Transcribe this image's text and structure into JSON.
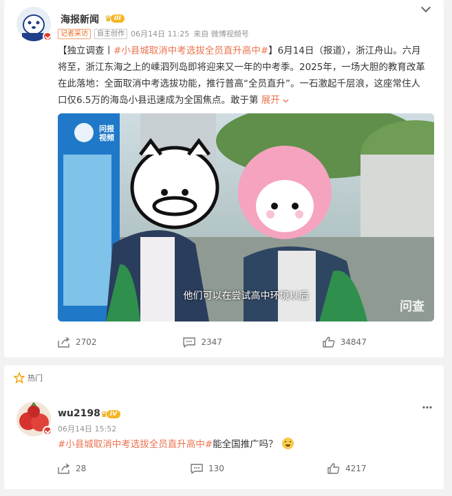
{
  "post": {
    "author": "海报新闻",
    "level": "III",
    "tags": [
      "记者采访",
      "自主创作"
    ],
    "date": "06月14日 11:25",
    "source": "来自 微博视频号",
    "text_prefix": "【独立调查丨",
    "hashtag": "#小县城取消中考选拔全员直升高中#",
    "text_body": "】6月14日（报道），浙江舟山。六月将至，浙江东海之上的嵊泗列岛即将迎来又一年的中考季。2025年，一场大胆的教育改革在此落地：全面取消中考选拔功能，推行普高“全员直升”。一石激起千层浪，这座常住人口仅6.5万的海岛小县迅速成为全国焦点。敢于第 ",
    "expand_label": "展开",
    "video": {
      "logo": "问报\n视频",
      "subtitle": "他们可以在尝试高中环境以后",
      "watermark": "问查"
    },
    "actions": {
      "shares": "2702",
      "comments": "2347",
      "likes": "34847"
    }
  },
  "hot_comment": {
    "header": "热门",
    "author": "wu2198",
    "level": "IV",
    "date": "06月14日 15:52",
    "hashtag": "#小县城取消中考选拔全员直升高中#",
    "text": "能全国推广吗？",
    "actions": {
      "shares": "28",
      "comments": "130",
      "likes": "4217"
    }
  },
  "icons": {
    "share": "share-icon",
    "comment": "comment-icon",
    "like": "thumbs-up-icon",
    "more": "chevron-down-icon",
    "hot": "star-outline-icon"
  },
  "colors": {
    "accent": "#eb7350",
    "badge": "#e0382c",
    "level": "#f5b622"
  }
}
